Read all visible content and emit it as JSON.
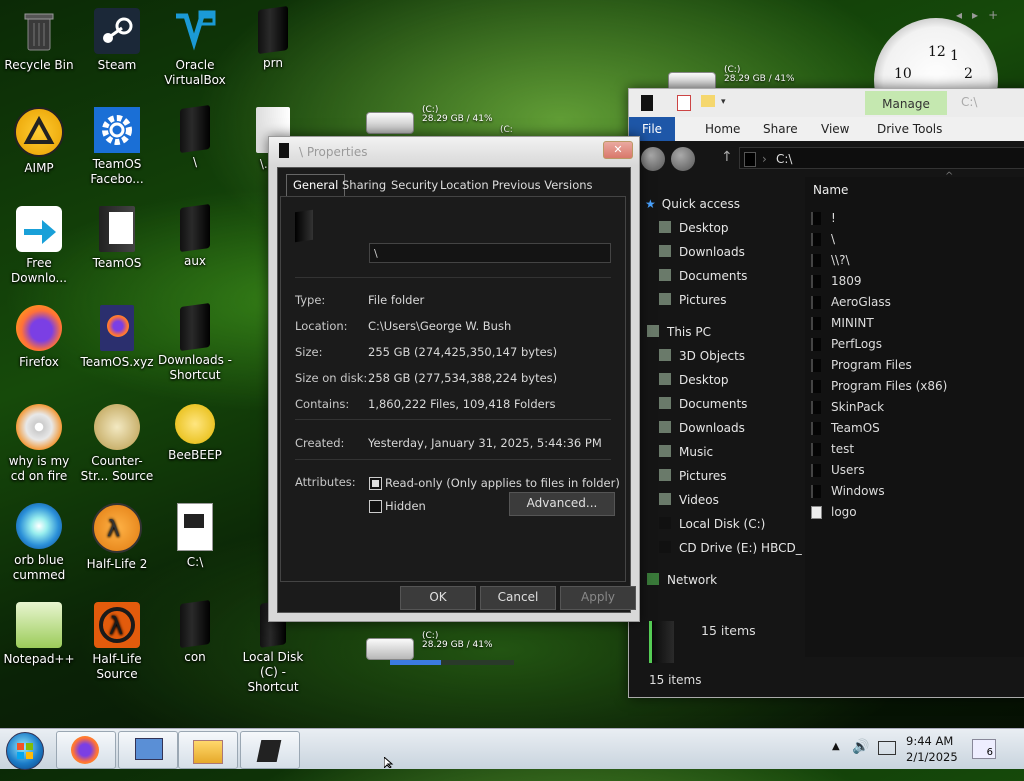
{
  "desktop": {
    "icons": [
      {
        "label": "Recycle Bin",
        "icon": "recycle-bin-icon"
      },
      {
        "label": "Steam",
        "icon": "steam-icon"
      },
      {
        "label": "Oracle VirtualBox",
        "icon": "virtualbox-icon"
      },
      {
        "label": "prn",
        "icon": "folder-icon"
      },
      {
        "label": "AIMP",
        "icon": "aimp-icon"
      },
      {
        "label": "TeamOS Facebo...",
        "icon": "settings-icon"
      },
      {
        "label": "\\",
        "icon": "folder-icon"
      },
      {
        "label": "\\..\\c\\",
        "icon": "folder-icon"
      },
      {
        "label": "Free Downlo...",
        "icon": "download-arrow-icon"
      },
      {
        "label": "TeamOS",
        "icon": "document-icon"
      },
      {
        "label": "aux",
        "icon": "folder-icon"
      },
      {
        "label": "Firefox",
        "icon": "firefox-icon"
      },
      {
        "label": "TeamOS.xyz",
        "icon": "firefox-file-icon"
      },
      {
        "label": "Downloads - Shortcut",
        "icon": "shortcut-folder-icon"
      },
      {
        "label": "why is my cd on fire",
        "icon": "cd-fire-icon"
      },
      {
        "label": "Counter-Str... Source",
        "icon": "counter-strike-icon"
      },
      {
        "label": "BeeBEEP",
        "icon": "bee-icon"
      },
      {
        "label": "orb blue cummed",
        "icon": "orb-icon"
      },
      {
        "label": "Half-Life 2",
        "icon": "half-life-2-icon"
      },
      {
        "label": "C:\\",
        "icon": "folder-icon"
      },
      {
        "label": "Notepad++",
        "icon": "notepad-plus-plus-icon"
      },
      {
        "label": "Half-Life Source",
        "icon": "half-life-icon"
      },
      {
        "label": "con",
        "icon": "folder-icon"
      },
      {
        "label": "Local Disk (C) - Shortcut",
        "icon": "drive-shortcut-icon"
      }
    ],
    "drive_widget": {
      "label": "(C:)",
      "usage": "28.29 GB / 41%",
      "label_partial": "(C:"
    },
    "clock_numbers": [
      "10",
      "12",
      "1",
      "2"
    ],
    "top_right_controls": [
      "◂",
      "▸",
      "+"
    ]
  },
  "properties": {
    "title": "\\ Properties",
    "tabs": [
      "General",
      "Sharing",
      "Security",
      "Location",
      "Previous Versions"
    ],
    "name_value": "\\",
    "fields": [
      {
        "label": "Type:",
        "value": "File folder"
      },
      {
        "label": "Location:",
        "value": "C:\\Users\\George W. Bush"
      },
      {
        "label": "Size:",
        "value": "255 GB (274,425,350,147 bytes)"
      },
      {
        "label": "Size on disk:",
        "value": "258 GB (277,534,388,224 bytes)"
      },
      {
        "label": "Contains:",
        "value": "1,860,222 Files, 109,418 Folders"
      }
    ],
    "created_label": "Created:",
    "created_value": "Yesterday, January 31, 2025, 5:44:36 PM",
    "attributes_label": "Attributes:",
    "readonly_label": "Read-only (Only applies to files in folder)",
    "hidden_label": "Hidden",
    "advanced_label": "Advanced...",
    "ok_label": "OK",
    "cancel_label": "Cancel",
    "apply_label": "Apply"
  },
  "explorer": {
    "ribbon_manage": "Manage",
    "ribbon_path": "C:\\",
    "menu": {
      "file": "File",
      "home": "Home",
      "share": "Share",
      "view": "View",
      "drive_tools": "Drive Tools"
    },
    "address": "C:\\",
    "nav": {
      "quick_access": "Quick access",
      "quick_items": [
        "Desktop",
        "Downloads",
        "Documents",
        "Pictures"
      ],
      "this_pc": "This PC",
      "pc_items": [
        "3D Objects",
        "Desktop",
        "Documents",
        "Downloads",
        "Music",
        "Pictures",
        "Videos",
        "Local Disk (C:)",
        "CD Drive (E:) HBCD_"
      ],
      "network": "Network"
    },
    "column_name": "Name",
    "files": [
      "!",
      "\\",
      "\\\\?\\",
      "1809",
      "AeroGlass",
      "MININT",
      "PerfLogs",
      "Program Files",
      "Program Files (x86)",
      "SkinPack",
      "TeamOS",
      "test",
      "Users",
      "Windows",
      "logo"
    ],
    "status_count": "15 items",
    "status_bar": "15 items"
  },
  "taskbar": {
    "time": "9:44 AM",
    "date": "2/1/2025",
    "notification_count": "6",
    "tray_up": "▲"
  },
  "colors": {
    "manage_tab": "#c5e8b0",
    "file_tab": "#1e57a8"
  }
}
